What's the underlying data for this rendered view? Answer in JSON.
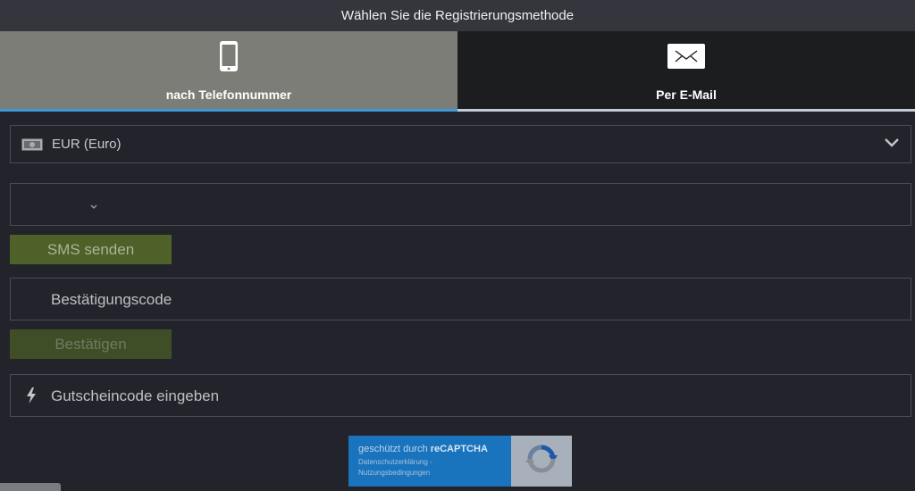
{
  "header": {
    "title": "Wählen Sie die Registrierungsmethode"
  },
  "tabs": [
    {
      "label": "nach Telefonnummer",
      "icon": "smartphone-icon",
      "active": true
    },
    {
      "label": "Per E-Mail",
      "icon": "envelope-icon",
      "active": false
    }
  ],
  "form": {
    "currency": {
      "icon": "banknote-icon",
      "value": "EUR (Euro)"
    },
    "phone": {
      "country_code": "",
      "value": ""
    },
    "sms_button": "SMS senden",
    "code": {
      "placeholder": "Bestätigungscode"
    },
    "confirm_button": "Bestätigen",
    "coupon": {
      "icon": "lightning-bolt-icon",
      "placeholder": "Gutscheincode eingeben"
    }
  },
  "recaptcha": {
    "text_prefix": "geschützt durch",
    "brand": "reCAPTCHA",
    "privacy": "Datenschutzerklärung",
    "separator": " - ",
    "terms": "Nutzungsbedingungen"
  },
  "colors": {
    "background": "#23242b",
    "active_tab": "#7c7d76",
    "inactive_tab": "#1c1d1f",
    "tab_indicator": "#3d9ad8",
    "sms_button": "#4e6128",
    "recaptcha_blue": "#1a74bd"
  }
}
